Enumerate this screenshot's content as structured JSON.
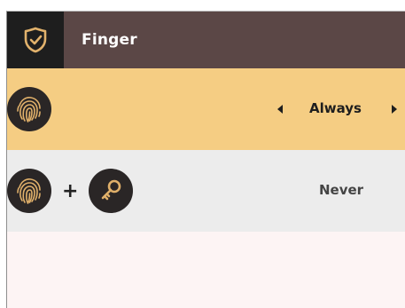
{
  "header": {
    "title": "Finger",
    "icon": "shield-check-icon",
    "background": "#5b4746"
  },
  "rows": [
    {
      "icons": [
        "fingerprint-icon"
      ],
      "value": "Always",
      "background": "#f5cd83"
    },
    {
      "icons": [
        "fingerprint-icon",
        "plus",
        "key-icon"
      ],
      "separator": "+",
      "value": "Never",
      "background": "#ececec"
    }
  ],
  "colors": {
    "accent": "#f5cd83",
    "icon_gold": "#e0b06a",
    "dark": "#2a2626"
  }
}
